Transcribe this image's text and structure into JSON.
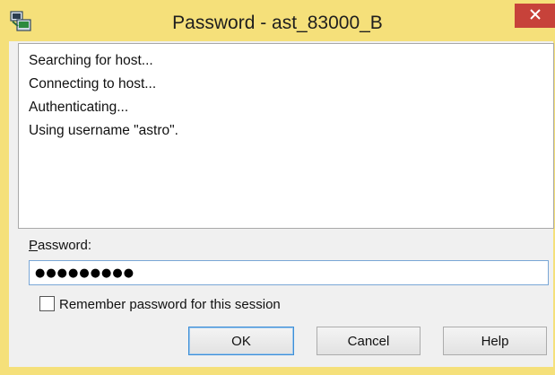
{
  "window": {
    "title": "Password - ast_83000_B",
    "app_icon": "putty-terminal-icon",
    "close_icon": "close-icon",
    "frame_color": "#f5e07a",
    "close_color": "#c7423a"
  },
  "log": {
    "lines": [
      "Searching for host...",
      "Connecting to host...",
      "Authenticating...",
      "Using username \"astro\"."
    ]
  },
  "password": {
    "label_mnemonic": "P",
    "label_rest": "assword:",
    "value": "●●●●●●●●●"
  },
  "remember": {
    "label": "Remember password for this session",
    "checked": false
  },
  "buttons": {
    "ok": "OK",
    "cancel": "Cancel",
    "help": "Help"
  }
}
